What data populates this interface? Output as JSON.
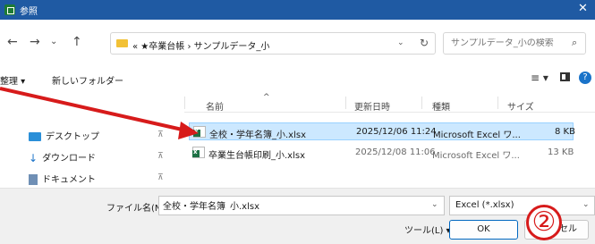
{
  "colors": {
    "titlebar": "#1f5aa3",
    "accent": "#0067c0",
    "selection": "#cce8ff",
    "annotation": "#d71b1b",
    "excel": "#1d7044",
    "folder": "#f2c136"
  },
  "window": {
    "title": "参照",
    "close_icon": "close-icon"
  },
  "address": {
    "path": "« ★卒業台帳 › サンプルデータ_小",
    "search_placeholder": "サンプルデータ_小の検索"
  },
  "toolbar": {
    "organize": "整理 ▾",
    "new_folder": "新しいフォルダー",
    "help": "?"
  },
  "nav": {
    "items": [
      {
        "label": "デスクトップ",
        "icon": "desktop-icon"
      },
      {
        "label": "ダウンロード",
        "icon": "download-icon"
      },
      {
        "label": "ドキュメント",
        "icon": "document-icon"
      }
    ],
    "pin": "📌"
  },
  "columns": {
    "name": "名前",
    "modified": "更新日時",
    "type": "種類",
    "size": "サイズ"
  },
  "files": [
    {
      "name": "全校・学年名簿_小.xlsx",
      "modified": "2025/12/06 11:24",
      "type": "Microsoft Excel ワ...",
      "size": "8 KB",
      "selected": true
    },
    {
      "name": "卒業生台帳印刷_小.xlsx",
      "modified": "2025/12/08 11:06",
      "type": "Microsoft Excel ワ...",
      "size": "13 KB",
      "selected": false
    }
  ],
  "bottom": {
    "filename_label": "ファイル名(N):",
    "filename_value": "全校・学年名簿_小.xlsx",
    "filter": "Excel (*.xlsx)",
    "tools": "ツール(L)  ▾",
    "ok": "OK",
    "cancel": "セル"
  },
  "annotation": {
    "callout": "②"
  }
}
